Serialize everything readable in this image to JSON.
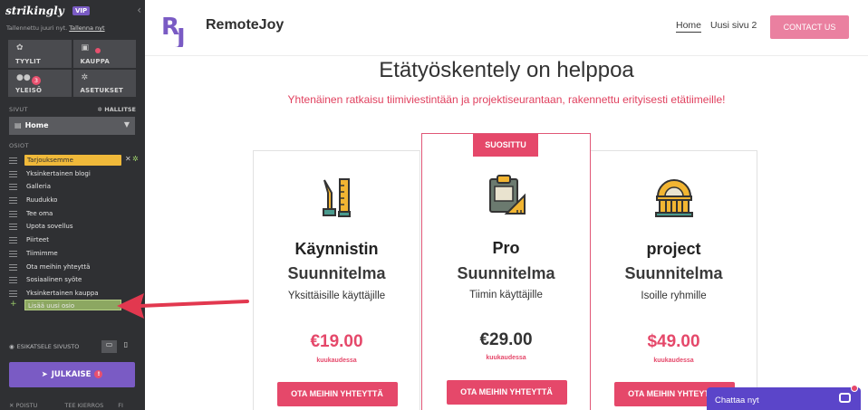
{
  "editor": {
    "logo": "strikingly",
    "vip": "VIP",
    "collapse_icon": "chevron-left-icon",
    "save_status": "Tallennettu juuri nyt.",
    "save_link": "Tallenna nyt",
    "tiles": [
      {
        "label": "TYYLIT",
        "icon": "palette-icon"
      },
      {
        "label": "KAUPPA",
        "icon": "shop-bag-icon"
      },
      {
        "label": "YLEISÖ",
        "icon": "users-icon",
        "badge": "3"
      },
      {
        "label": "ASETUKSET",
        "icon": "gear-icon"
      }
    ],
    "pages_label": "SIVUT",
    "manage_label": "HALLITSE",
    "current_page": "Home",
    "sections_label": "OSIOT",
    "sections": [
      "Tarjouksemme",
      "Yksinkertainen blogi",
      "Galleria",
      "Ruudukko",
      "Tee oma",
      "Upota sovellus",
      "Piirteet",
      "Tiimimme",
      "Ota meihin yhteyttä",
      "Sosiaalinen syöte",
      "Yksinkertainen kauppa"
    ],
    "add_section": "Lisää uusi osio",
    "preview_label": "ESIKATSELE SIVUSTO",
    "publish_label": "JULKAISE",
    "publish_warning": "!",
    "footer": [
      "POISTU",
      "TEE KIERROS",
      "FI"
    ]
  },
  "site": {
    "brand_mark": "RJ",
    "brand_name": "RemoteJoy",
    "nav": [
      "Home",
      "Uusi sivu 2"
    ],
    "contact_button": "CONTACT US",
    "title": "Etätyöskentely on helppoa",
    "subtitle": "Yhtenäinen ratkaisu tiimiviestintään ja projektiseurantaan, rakennettu erityisesti etätiimeille!",
    "plans": [
      {
        "title_line1": "Käynnistin",
        "title_line2": "Suunnitelma",
        "audience": "Yksittäisille käyttäjille",
        "price": "€19.00",
        "period": "kuukaudessa",
        "cta": "OTA MEIHIN YHTEYTTÄ",
        "icon": "drafting-tools-icon",
        "price_color": "#e5486a"
      },
      {
        "ribbon": "SUOSITTU",
        "title_line1": "Pro",
        "title_line2": "Suunnitelma",
        "audience": "Tiimin käyttäjille",
        "price": "€29.00",
        "period": "kuukaudessa",
        "cta": "OTA MEIHIN YHTEYTTÄ",
        "icon": "clipboard-ruler-icon",
        "price_color": "#333333"
      },
      {
        "title_line1": "project",
        "title_line2": "Suunnitelma",
        "audience": "Isoille ryhmille",
        "price": "$49.00",
        "period": "kuukaudessa",
        "cta": "OTA MEIHIN YHTEYTTÄ",
        "icon": "building-icon",
        "price_color": "#e5486a"
      }
    ],
    "chat_label": "Chattaa nyt"
  },
  "colors": {
    "accent": "#e5486a",
    "purple": "#7a5bc4",
    "sidebar": "#2f3033",
    "highlight": "#f0b93a",
    "add_green": "#8ca761"
  }
}
